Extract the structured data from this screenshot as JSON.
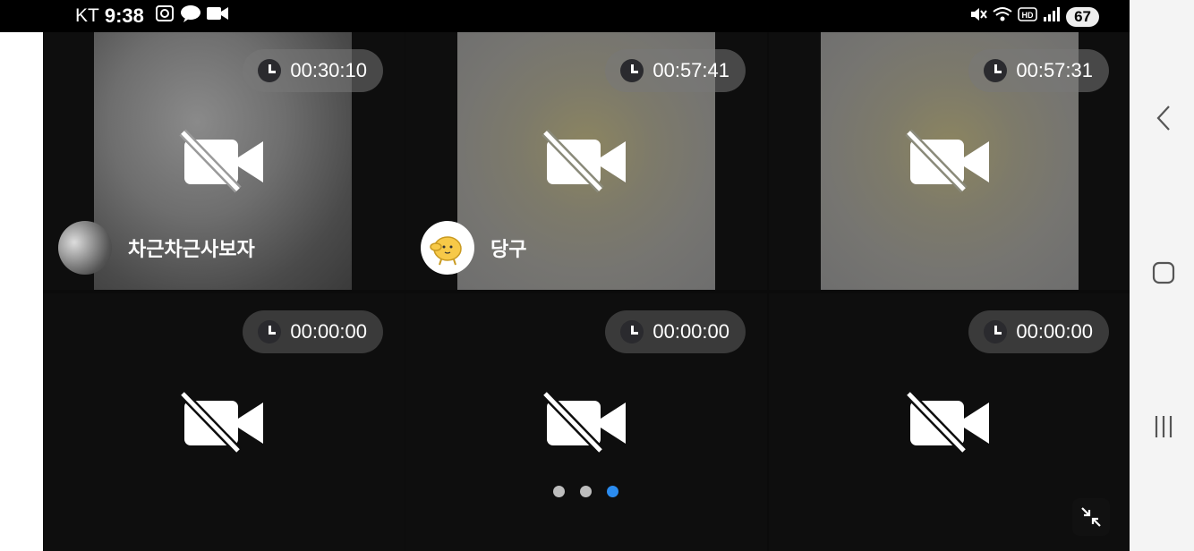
{
  "status_bar": {
    "carrier": "KT",
    "time": "9:38",
    "battery": "67"
  },
  "tiles": [
    {
      "timer": "00:30:10",
      "name": "차근차근사보자"
    },
    {
      "timer": "00:57:41",
      "name": "당구"
    },
    {
      "timer": "00:57:31"
    },
    {
      "timer": "00:00:00"
    },
    {
      "timer": "00:00:00"
    },
    {
      "timer": "00:00:00"
    }
  ],
  "pagination": {
    "count": 3,
    "active_index": 2
  },
  "colors": {
    "accent": "#2b8cf0",
    "background": "#0b0b0b",
    "nav_bar": "#f4f4f4"
  },
  "icons": [
    "camera-off-icon",
    "clock-icon",
    "minimize-icon",
    "back-icon",
    "home-icon",
    "recents-icon"
  ]
}
